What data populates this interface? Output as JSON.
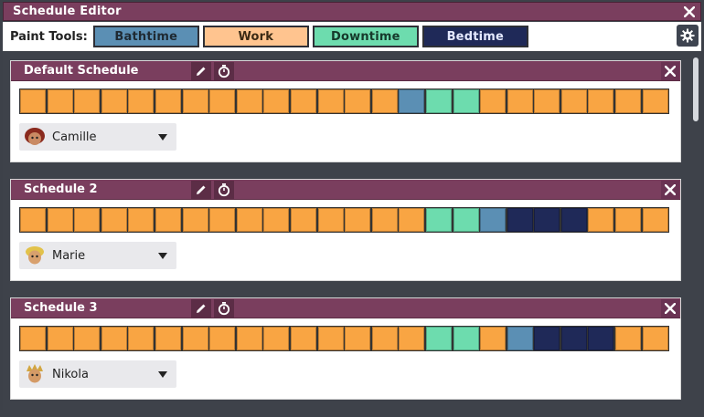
{
  "window": {
    "title": "Schedule Editor"
  },
  "toolbar": {
    "label": "Paint Tools:",
    "tools": [
      {
        "label": "Bathtime",
        "color": "#5b8fb4",
        "text_color": "#1f2a33"
      },
      {
        "label": "Work",
        "color": "#ffc48f",
        "text_color": "#3b2a14"
      },
      {
        "label": "Downtime",
        "color": "#6ddcae",
        "text_color": "#163a2b"
      },
      {
        "label": "Bedtime",
        "color": "#1f2958",
        "text_color": "#e4e8ff"
      }
    ]
  },
  "colors": {
    "work": "#f9a543",
    "bath": "#5b8fb4",
    "down": "#6ddcae",
    "bed": "#1f2958"
  },
  "schedules": [
    {
      "name": "Default Schedule",
      "blocks": [
        "work",
        "work",
        "work",
        "work",
        "work",
        "work",
        "work",
        "work",
        "work",
        "work",
        "work",
        "work",
        "work",
        "work",
        "bath",
        "down",
        "down",
        "work",
        "work",
        "work",
        "work",
        "work",
        "work",
        "work"
      ],
      "dupe": "Camille"
    },
    {
      "name": "Schedule 2",
      "blocks": [
        "work",
        "work",
        "work",
        "work",
        "work",
        "work",
        "work",
        "work",
        "work",
        "work",
        "work",
        "work",
        "work",
        "work",
        "work",
        "down",
        "down",
        "bath",
        "bed",
        "bed",
        "bed",
        "work",
        "work",
        "work"
      ],
      "dupe": "Marie"
    },
    {
      "name": "Schedule 3",
      "blocks": [
        "work",
        "work",
        "work",
        "work",
        "work",
        "work",
        "work",
        "work",
        "work",
        "work",
        "work",
        "work",
        "work",
        "work",
        "work",
        "down",
        "down",
        "work",
        "bath",
        "bed",
        "bed",
        "bed",
        "work",
        "work"
      ],
      "dupe": "Nikola"
    }
  ]
}
